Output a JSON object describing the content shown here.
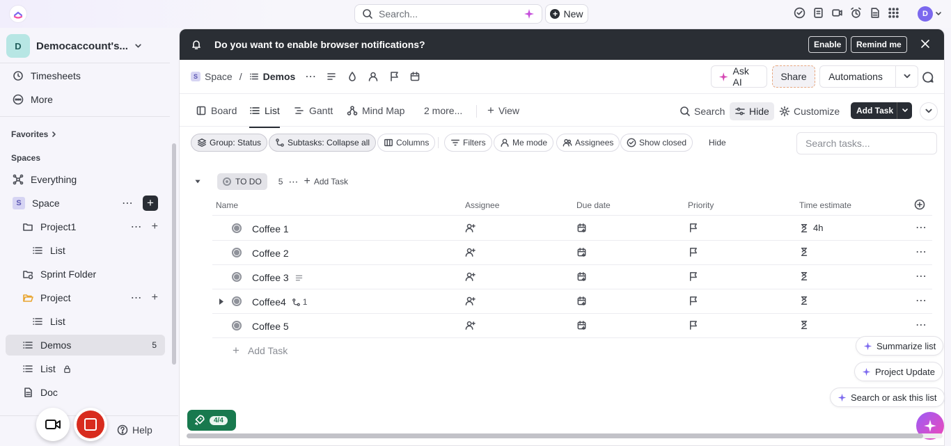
{
  "topbar": {
    "search_placeholder": "Search...",
    "new_label": "New",
    "avatar_initial": "D"
  },
  "sidebar": {
    "workspace_initial": "D",
    "workspace_name": "Democaccount's...",
    "items_top": [
      {
        "label": "Timesheets",
        "icon": "timer-icon"
      },
      {
        "label": "More",
        "icon": "more-circle-icon"
      }
    ],
    "favorites_label": "Favorites",
    "spaces_label": "Spaces",
    "everything_label": "Everything",
    "space": {
      "initial": "S",
      "label": "Space"
    },
    "tree": [
      {
        "label": "Project1",
        "icon": "folder-icon"
      },
      {
        "label": "List",
        "icon": "list-icon"
      },
      {
        "label": "Sprint Folder",
        "icon": "sprint-folder-icon"
      },
      {
        "label": "Project",
        "icon": "folder-open-icon"
      },
      {
        "label": "List",
        "icon": "list-icon"
      },
      {
        "label": "Demos",
        "icon": "list-icon",
        "count": "5"
      },
      {
        "label": "List",
        "icon": "list-icon"
      },
      {
        "label": "Doc",
        "icon": "doc-icon"
      }
    ],
    "help_label": "Help"
  },
  "notification": {
    "text": "Do you want to enable browser notifications?",
    "enable_label": "Enable",
    "remind_label": "Remind me"
  },
  "breadcrumb": {
    "space_initial": "S",
    "space": "Space",
    "separator": "/",
    "current": "Demos"
  },
  "header_actions": {
    "ask_ai": "Ask AI",
    "share": "Share",
    "automations": "Automations"
  },
  "views": {
    "tabs": [
      "Board",
      "List",
      "Gantt",
      "Mind Map",
      "2 more..."
    ],
    "add_view": "View",
    "search": "Search",
    "hide": "Hide",
    "customize": "Customize",
    "add_task": "Add Task"
  },
  "filters": {
    "group": "Group: Status",
    "subtasks": "Subtasks: Collapse all",
    "columns": "Columns",
    "filters": "Filters",
    "me_mode": "Me mode",
    "assignees": "Assignees",
    "show_closed": "Show closed",
    "hide": "Hide",
    "search_placeholder": "Search tasks..."
  },
  "group": {
    "status": "TO DO",
    "count": "5",
    "add_task": "Add Task"
  },
  "columns": [
    "Name",
    "Assignee",
    "Due date",
    "Priority",
    "Time estimate"
  ],
  "tasks": [
    {
      "name": "Coffee 1",
      "time": "4h"
    },
    {
      "name": "Coffee 2",
      "time": ""
    },
    {
      "name": "Coffee 3",
      "time": ""
    },
    {
      "name": "Coffee4",
      "time": "",
      "subtasks": "1"
    },
    {
      "name": "Coffee 5",
      "time": ""
    }
  ],
  "add_task_row": "Add Task",
  "floating": {
    "summarize": "Summarize list",
    "project_update": "Project Update",
    "search_ask": "Search or ask this list"
  },
  "onboarding_progress": "4/4"
}
